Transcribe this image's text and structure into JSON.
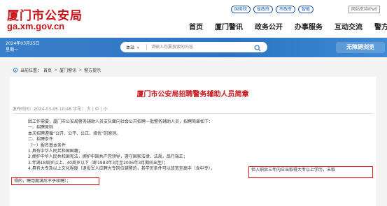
{
  "header": {
    "logo_cn": "厦门市公安局",
    "logo_en": "ga.xm.gov.cn",
    "top_links": [
      "国务院",
      "省政府",
      "市政府",
      "智能"
    ],
    "ipv6": "网站支持IPv6",
    "nav": [
      "首页",
      "厦门警讯",
      "政务公开",
      "办事服务",
      "互动交流",
      "警方提示"
    ]
  },
  "band": {
    "date": "2024年03月25日",
    "weekday": "星期一",
    "scope": "本站",
    "search_placeholder": "请输入您要搜索的内容",
    "barrier_free": "无障碍浏览"
  },
  "breadcrumb": {
    "label": "当前位置：",
    "items": [
      "首页",
      "厦门警讯",
      "警方提示"
    ]
  },
  "article": {
    "title": "厦门市公安局招聘警务辅助人员简章",
    "meta_prefix": "发布时间：2024-03-05 10:48 字号：",
    "font_sizes": [
      "大",
      "中",
      "小"
    ],
    "lines": [
      "因工作需要，厦门市公安局警务辅助人员支队面向社会公开招聘一批警务辅助人员，招聘简章如下：",
      "一、招聘原则",
      "本次招聘遵循“公开、公平、公正、择优”的原则。",
      "二、招聘条件",
      "（一）报名基本条件",
      "1.具有中华人民共和国国籍；",
      "2.拥护中华人民共和国宪法，拥护中国共产党领导，遵守国家法律、法规，品行端正；",
      "3.年满18周岁以上、40周岁以下（即1983年3月至2006年3月期间出生）；",
      "4.具有大专及以上文化程度（退役军人应聘大专岗位辅警的，其学历条件可以放宽至高中（含中专），"
    ],
    "highlight_1": "但入职后三年内应当取得大专以上学历，未取",
    "highlight_2": "得的，聘用期满后不予续聘）；"
  }
}
